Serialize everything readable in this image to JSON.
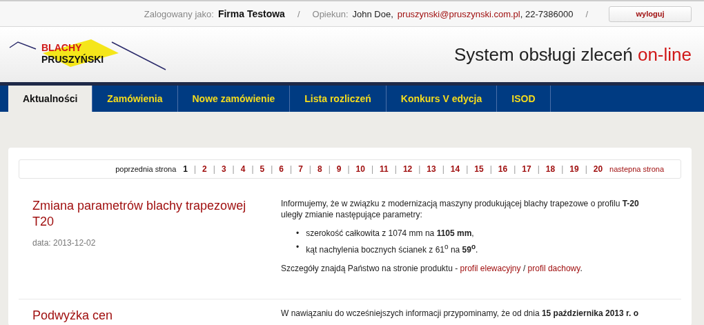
{
  "top_bar": {
    "logged_label": "Zalogowany jako:",
    "company": "Firma Testowa",
    "separator": "/",
    "advisor_label": "Opiekun:",
    "advisor_name": "John Doe,",
    "advisor_email": "pruszynski@pruszynski.com.pl",
    "advisor_phone": ", 22-7386000",
    "separator_2": "/",
    "logout": "wyloguj"
  },
  "logo": {
    "line1": "BLACHY",
    "line2": "PRUSZYŃSKI"
  },
  "header": {
    "title": "System obsługi zleceń",
    "title_accent": "on-line"
  },
  "tabs": [
    {
      "label": "Aktualności",
      "selected": true
    },
    {
      "label": "Zamówienia",
      "selected": false
    },
    {
      "label": "Nowe zamówienie",
      "selected": false
    },
    {
      "label": "Lista rozliczeń",
      "selected": false
    },
    {
      "label": "Konkurs V edycja",
      "selected": false
    },
    {
      "label": "ISOD",
      "selected": false
    }
  ],
  "pagination": {
    "prev": "poprzednia strona",
    "separator": "|",
    "next": "nastepna strona",
    "pages": [
      {
        "label": "1",
        "selected": true
      },
      {
        "label": "2",
        "selected": false
      },
      {
        "label": "3",
        "selected": false
      },
      {
        "label": "4",
        "selected": false
      },
      {
        "label": "5",
        "selected": false
      },
      {
        "label": "6",
        "selected": false
      },
      {
        "label": "7",
        "selected": false
      },
      {
        "label": "8",
        "selected": false
      },
      {
        "label": "9",
        "selected": false
      },
      {
        "label": "10",
        "selected": false
      },
      {
        "label": "11",
        "selected": false
      },
      {
        "label": "12",
        "selected": false
      },
      {
        "label": "13",
        "selected": false
      },
      {
        "label": "14",
        "selected": false
      },
      {
        "label": "15",
        "selected": false
      },
      {
        "label": "16",
        "selected": false
      },
      {
        "label": "17",
        "selected": false
      },
      {
        "label": "18",
        "selected": false
      },
      {
        "label": "19",
        "selected": false
      },
      {
        "label": "20",
        "selected": false
      }
    ]
  },
  "articles": [
    {
      "title": "Zmiana parametrów blachy trapezowej T20",
      "date": "data: 2013-12-02",
      "intro": "Informujemy, że w związku z modernizacją maszyny produkującej blachy trapezowe o profilu **T-20** uległy zmianie następujące parametry:",
      "bullet_marker": "•",
      "bullets": [
        "szerokość całkowita z 1074 mm na **1105 mm**,",
        "kąt nachylenia bocznych ścianek z 61$^{o}$ na **59$^{o}$**."
      ],
      "outro": "Szczegóły znajdą Państwo na stronie produktu -",
      "links": [
        "profil elewacyjny",
        "profil dachowy"
      ],
      "link_separator": "/",
      "end": "."
    },
    {
      "title": "Podwyżka cen",
      "intro": "W nawiązaniu do wcześniejszych informacji przypominamy, że od dnia **15 października 2013 r. o**"
    }
  ]
}
